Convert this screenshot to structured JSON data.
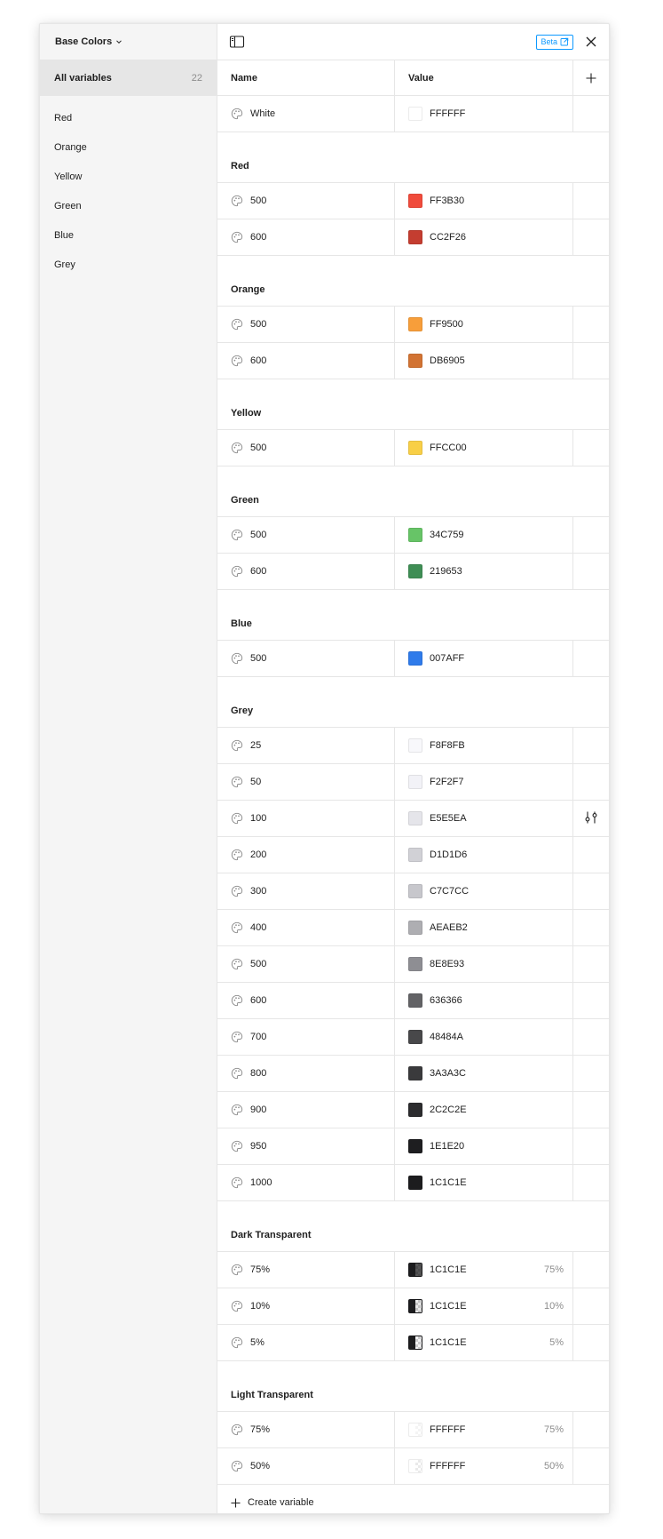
{
  "collection": {
    "title": "Base Colors"
  },
  "sidebar": {
    "all_label": "All variables",
    "all_count": "22",
    "groups": [
      "Red",
      "Orange",
      "Yellow",
      "Green",
      "Blue",
      "Grey"
    ]
  },
  "toolbar": {
    "beta_label": "Beta"
  },
  "table": {
    "name_header": "Name",
    "value_header": "Value",
    "ungrouped": [
      {
        "name": "White",
        "hex": "FFFFFF",
        "color": "#FFFFFF"
      }
    ],
    "groups": [
      {
        "title": "Red",
        "rows": [
          {
            "name": "500",
            "hex": "FF3B30",
            "color": "#F04B3C"
          },
          {
            "name": "600",
            "hex": "CC2F26",
            "color": "#C43D30"
          }
        ]
      },
      {
        "title": "Orange",
        "rows": [
          {
            "name": "500",
            "hex": "FF9500",
            "color": "#F79E3A"
          },
          {
            "name": "600",
            "hex": "DB6905",
            "color": "#D27333"
          }
        ]
      },
      {
        "title": "Yellow",
        "rows": [
          {
            "name": "500",
            "hex": "FFCC00",
            "color": "#F8CF47"
          }
        ]
      },
      {
        "title": "Green",
        "rows": [
          {
            "name": "500",
            "hex": "34C759",
            "color": "#67C467"
          },
          {
            "name": "600",
            "hex": "219653",
            "color": "#3F8E55"
          }
        ]
      },
      {
        "title": "Blue",
        "rows": [
          {
            "name": "500",
            "hex": "007AFF",
            "color": "#2F7BEA"
          }
        ]
      },
      {
        "title": "Grey",
        "rows": [
          {
            "name": "25",
            "hex": "F8F8FB",
            "color": "#F8F8FB"
          },
          {
            "name": "50",
            "hex": "F2F2F7",
            "color": "#F2F2F7"
          },
          {
            "name": "100",
            "hex": "E5E5EA",
            "color": "#E5E5EA",
            "hovered": true
          },
          {
            "name": "200",
            "hex": "D1D1D6",
            "color": "#D1D1D6"
          },
          {
            "name": "300",
            "hex": "C7C7CC",
            "color": "#C7C7CC"
          },
          {
            "name": "400",
            "hex": "AEAEB2",
            "color": "#AEAEB2"
          },
          {
            "name": "500",
            "hex": "8E8E93",
            "color": "#8E8E93"
          },
          {
            "name": "600",
            "hex": "636366",
            "color": "#636366"
          },
          {
            "name": "700",
            "hex": "48484A",
            "color": "#48484A"
          },
          {
            "name": "800",
            "hex": "3A3A3C",
            "color": "#3A3A3C"
          },
          {
            "name": "900",
            "hex": "2C2C2E",
            "color": "#2C2C2E"
          },
          {
            "name": "950",
            "hex": "1E1E20",
            "color": "#1E1E20"
          },
          {
            "name": "1000",
            "hex": "1C1C1E",
            "color": "#1C1C1E"
          }
        ]
      },
      {
        "title": "Dark Transparent",
        "rows": [
          {
            "name": "75%",
            "hex": "1C1C1E",
            "color": "#1C1C1E",
            "alpha": "75%",
            "alpha_value": 0.75
          },
          {
            "name": "10%",
            "hex": "1C1C1E",
            "color": "#1C1C1E",
            "alpha": "10%",
            "alpha_value": 0.1
          },
          {
            "name": "5%",
            "hex": "1C1C1E",
            "color": "#1C1C1E",
            "alpha": "5%",
            "alpha_value": 0.05
          }
        ]
      },
      {
        "title": "Light Transparent",
        "rows": [
          {
            "name": "75%",
            "hex": "FFFFFF",
            "color": "#FFFFFF",
            "alpha": "75%",
            "alpha_value": 0.75
          },
          {
            "name": "50%",
            "hex": "FFFFFF",
            "color": "#FFFFFF",
            "alpha": "50%",
            "alpha_value": 0.5
          }
        ]
      }
    ]
  },
  "footer": {
    "create_label": "Create variable"
  }
}
